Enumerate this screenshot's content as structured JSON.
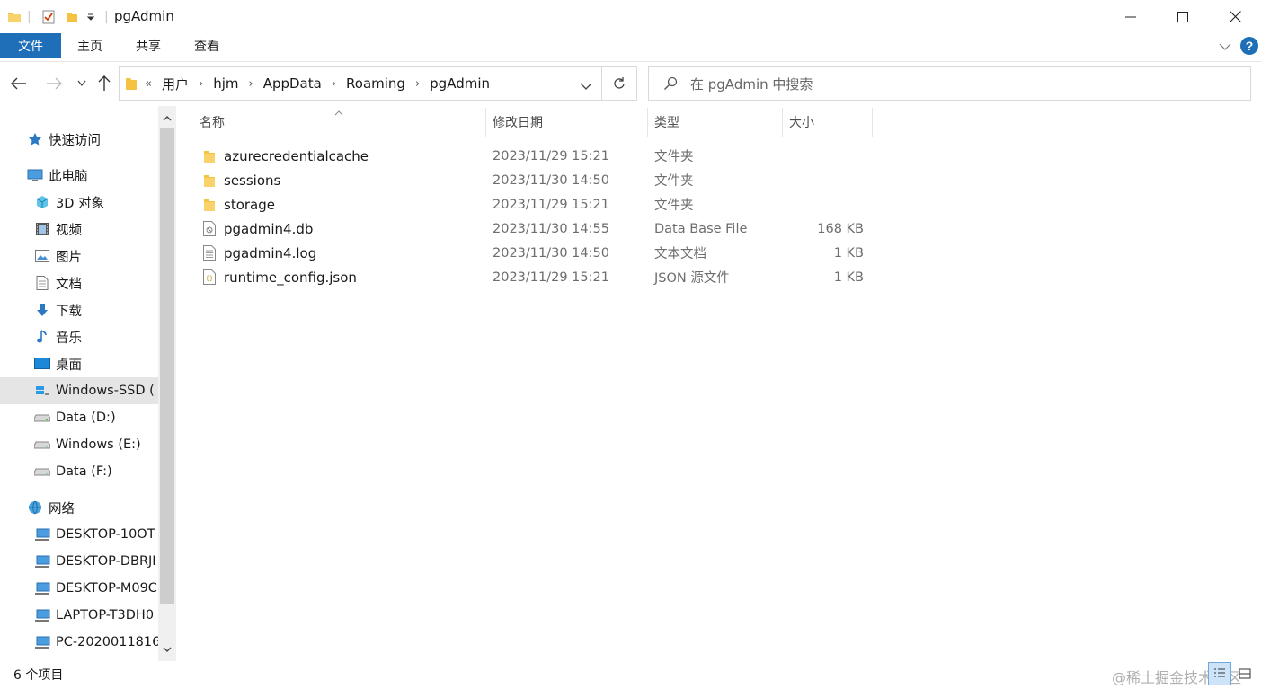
{
  "window": {
    "title": "pgAdmin"
  },
  "ribbon": {
    "tabs": [
      {
        "label": "文件"
      },
      {
        "label": "主页"
      },
      {
        "label": "共享"
      },
      {
        "label": "查看"
      }
    ]
  },
  "address": {
    "overflow": "«",
    "crumbs": [
      "用户",
      "hjm",
      "AppData",
      "Roaming",
      "pgAdmin"
    ]
  },
  "search": {
    "placeholder": "在 pgAdmin 中搜索"
  },
  "nav": {
    "items": [
      {
        "label": "快速访问",
        "icon": "star-icon"
      },
      {
        "label": "此电脑",
        "icon": "computer-icon"
      },
      {
        "label": "3D 对象",
        "icon": "cube-icon"
      },
      {
        "label": "视频",
        "icon": "film-icon"
      },
      {
        "label": "图片",
        "icon": "picture-icon"
      },
      {
        "label": "文档",
        "icon": "document-icon"
      },
      {
        "label": "下载",
        "icon": "download-arrow-icon"
      },
      {
        "label": "音乐",
        "icon": "music-note-icon"
      },
      {
        "label": "桌面",
        "icon": "desktop-icon"
      },
      {
        "label": "Windows-SSD (",
        "icon": "windows-drive-icon"
      },
      {
        "label": "Data (D:)",
        "icon": "drive-icon"
      },
      {
        "label": "Windows (E:)",
        "icon": "drive-icon"
      },
      {
        "label": "Data (F:)",
        "icon": "drive-icon"
      },
      {
        "label": "网络",
        "icon": "network-icon"
      },
      {
        "label": "DESKTOP-10OT",
        "icon": "network-computer-icon"
      },
      {
        "label": "DESKTOP-DBRJI",
        "icon": "network-computer-icon"
      },
      {
        "label": "DESKTOP-M09C",
        "icon": "network-computer-icon"
      },
      {
        "label": "LAPTOP-T3DH0",
        "icon": "network-computer-icon"
      },
      {
        "label": "PC-2020011816",
        "icon": "network-computer-icon"
      }
    ]
  },
  "files": {
    "columns": {
      "name": "名称",
      "modified": "修改日期",
      "type": "类型",
      "size": "大小"
    },
    "rows": [
      {
        "name": "azurecredentialcache",
        "modified": "2023/11/29 15:21",
        "type": "文件夹",
        "size": "",
        "icon": "folder-icon"
      },
      {
        "name": "sessions",
        "modified": "2023/11/30 14:50",
        "type": "文件夹",
        "size": "",
        "icon": "folder-icon"
      },
      {
        "name": "storage",
        "modified": "2023/11/29 15:21",
        "type": "文件夹",
        "size": "",
        "icon": "folder-icon"
      },
      {
        "name": "pgadmin4.db",
        "modified": "2023/11/30 14:55",
        "type": "Data Base File",
        "size": "168 KB",
        "icon": "db-file-icon"
      },
      {
        "name": "pgadmin4.log",
        "modified": "2023/11/30 14:50",
        "type": "文本文档",
        "size": "1 KB",
        "icon": "text-file-icon"
      },
      {
        "name": "runtime_config.json",
        "modified": "2023/11/29 15:21",
        "type": "JSON 源文件",
        "size": "1 KB",
        "icon": "json-file-icon"
      }
    ]
  },
  "status": {
    "count": "6 个项目",
    "watermark": "@稀土掘金技术社区"
  },
  "colors": {
    "accent": "#1e6fb8",
    "folder": "#f5c242",
    "selection": "#e5e5e5"
  }
}
